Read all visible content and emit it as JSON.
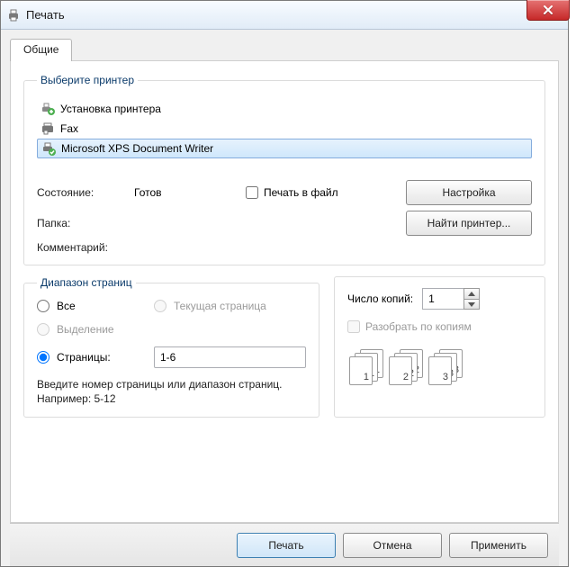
{
  "window": {
    "title": "Печать"
  },
  "tabs": {
    "general": "Общие"
  },
  "printer_group": {
    "legend": "Выберите принтер",
    "items": [
      {
        "label": "Установка принтера",
        "icon": "add-printer-icon",
        "selected": false
      },
      {
        "label": "Fax",
        "icon": "fax-icon",
        "selected": false
      },
      {
        "label": "Microsoft XPS Document Writer",
        "icon": "printer-ok-icon",
        "selected": true
      }
    ],
    "status_label": "Состояние:",
    "status_value": "Готов",
    "folder_label": "Папка:",
    "folder_value": "",
    "comment_label": "Комментарий:",
    "comment_value": "",
    "print_to_file": "Печать в файл",
    "settings_btn": "Настройка",
    "find_printer_btn": "Найти принтер..."
  },
  "range_group": {
    "legend": "Диапазон страниц",
    "all": "Все",
    "current": "Текущая страница",
    "selection": "Выделение",
    "pages": "Страницы:",
    "pages_value": "1-6",
    "hint": "Введите номер страницы или диапазон страниц.  Например: 5-12"
  },
  "copies_group": {
    "count_label": "Число копий:",
    "count_value": "1",
    "collate": "Разобрать по копиям",
    "stack_labels": [
      "1",
      "2",
      "3"
    ]
  },
  "footer": {
    "print": "Печать",
    "cancel": "Отмена",
    "apply": "Применить"
  }
}
